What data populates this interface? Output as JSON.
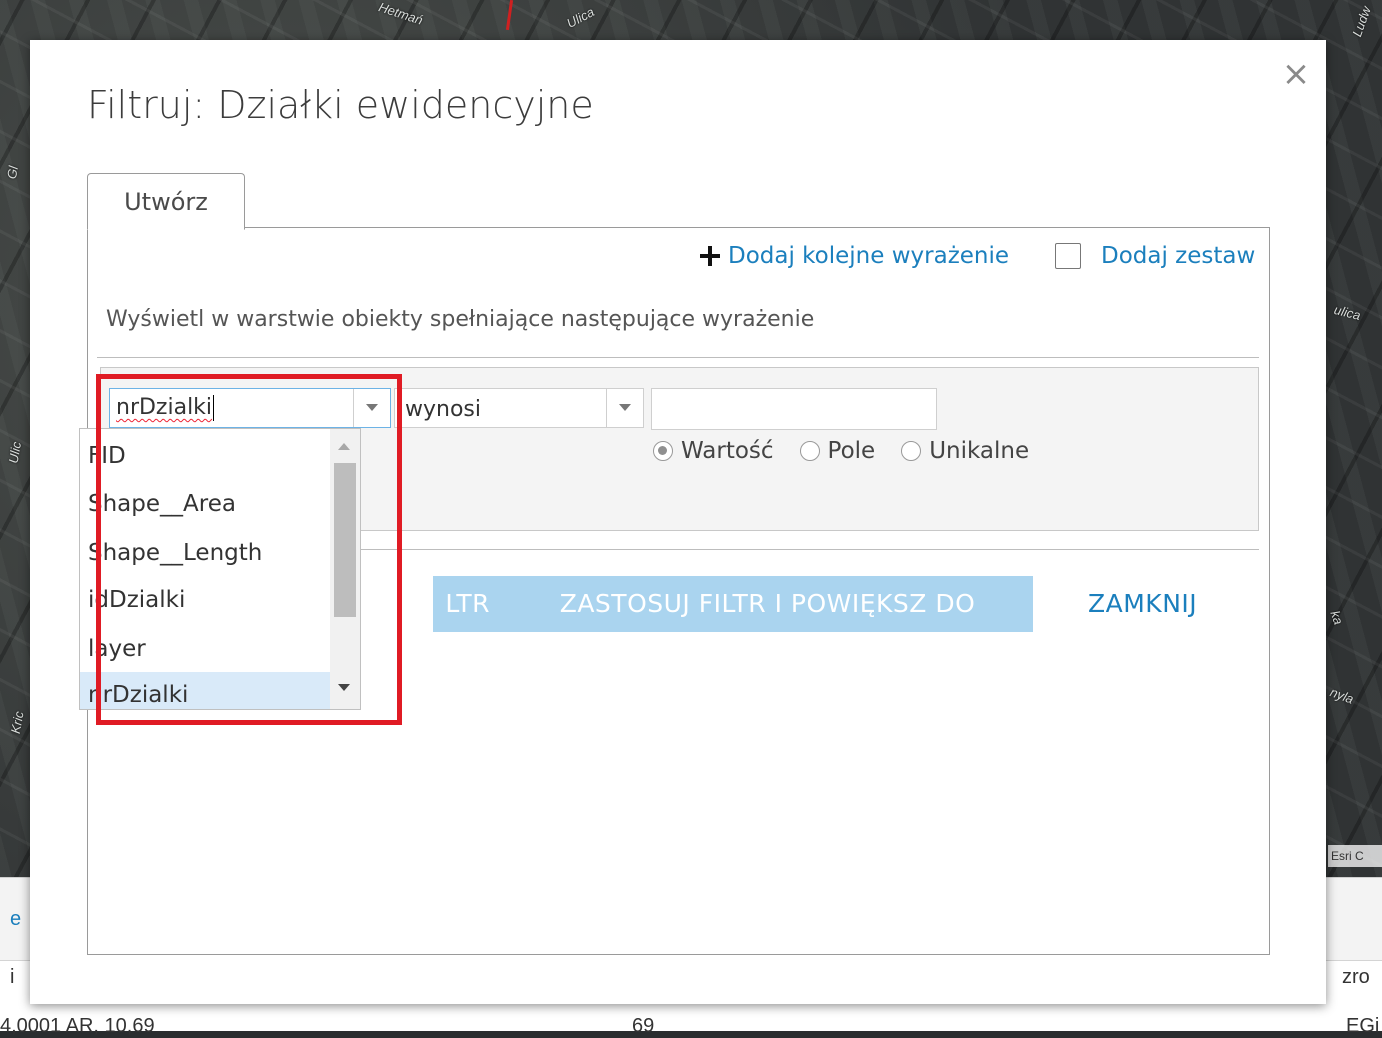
{
  "map": {
    "street_labels": [
      "Hetmań",
      "Ulica",
      "ulica",
      "Ludw",
      "Gl",
      "ka",
      "nyla",
      "Ulic",
      "Kric"
    ],
    "attribution": "Esri C"
  },
  "attribute_table": {
    "header_left": "i",
    "header_right": "zro",
    "row_values": [
      "4,0001 AR, 10,69",
      "69",
      "EGi"
    ],
    "tab_letter": "e"
  },
  "dialog": {
    "title": "Filtruj: Działki ewidencyjne",
    "close_label": "×",
    "tab_label": "Utwórz",
    "add_expression_label": "Dodaj kolejne wyrażenie",
    "add_set_label": "Dodaj zestaw",
    "description": "Wyświetl w warstwie obiekty spełniające następujące wyrażenie",
    "field_value": "nrDzialki",
    "operator_value": "wynosi",
    "value_input": "",
    "radio_options": [
      {
        "label": "Wartość",
        "checked": true
      },
      {
        "label": "Pole",
        "checked": false
      },
      {
        "label": "Unikalne",
        "checked": false
      }
    ],
    "field_options": [
      "FID",
      "Shape__Area",
      "Shape__Length",
      "idDzialki",
      "layer",
      "nrDzialki"
    ],
    "selected_option": "nrDzialki",
    "apply_button_visible": "LTR",
    "apply_zoom_button": "ZASTOSUJ FILTR I POWIĘKSZ DO",
    "close_button": "ZAMKNIJ"
  },
  "colors": {
    "accent": "#1b7fbd",
    "disabled_button": "#aad4ef",
    "highlight_frame": "#e01b24",
    "selected_option_bg": "#d9eaf9"
  },
  "icons": [
    "plus-icon",
    "checkbox-icon",
    "close-icon",
    "chevron-down-icon",
    "scroll-up-icon",
    "scroll-down-icon"
  ]
}
